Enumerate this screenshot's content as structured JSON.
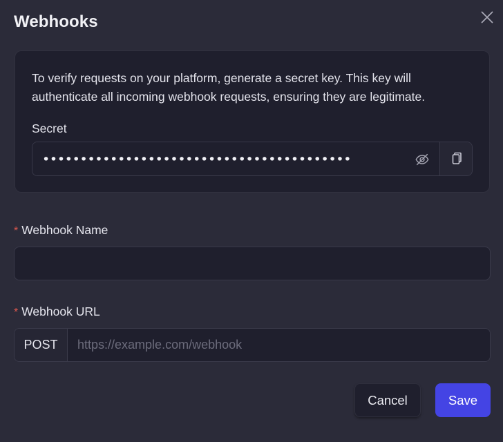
{
  "dialog": {
    "title": "Webhooks",
    "close_icon": "close-icon"
  },
  "secret_panel": {
    "description": "To verify requests on your platform, generate a secret key. This key will authenticate all incoming webhook requests, ensuring they are legitimate.",
    "label": "Secret",
    "masked_value": "•••••••••••••••••••••••••••••••••••••••••",
    "toggle_icon": "eye-off-icon",
    "copy_icon": "copy-icon"
  },
  "webhook_name": {
    "required_marker": "*",
    "label": "Webhook Name",
    "value": "",
    "placeholder": ""
  },
  "webhook_url": {
    "required_marker": "*",
    "label": "Webhook URL",
    "method": "POST",
    "value": "",
    "placeholder": "https://example.com/webhook"
  },
  "actions": {
    "cancel_label": "Cancel",
    "save_label": "Save"
  },
  "colors": {
    "background": "#2b2b39",
    "panel": "#1f1f2d",
    "accent": "#4444e4",
    "required": "#e0584f"
  }
}
